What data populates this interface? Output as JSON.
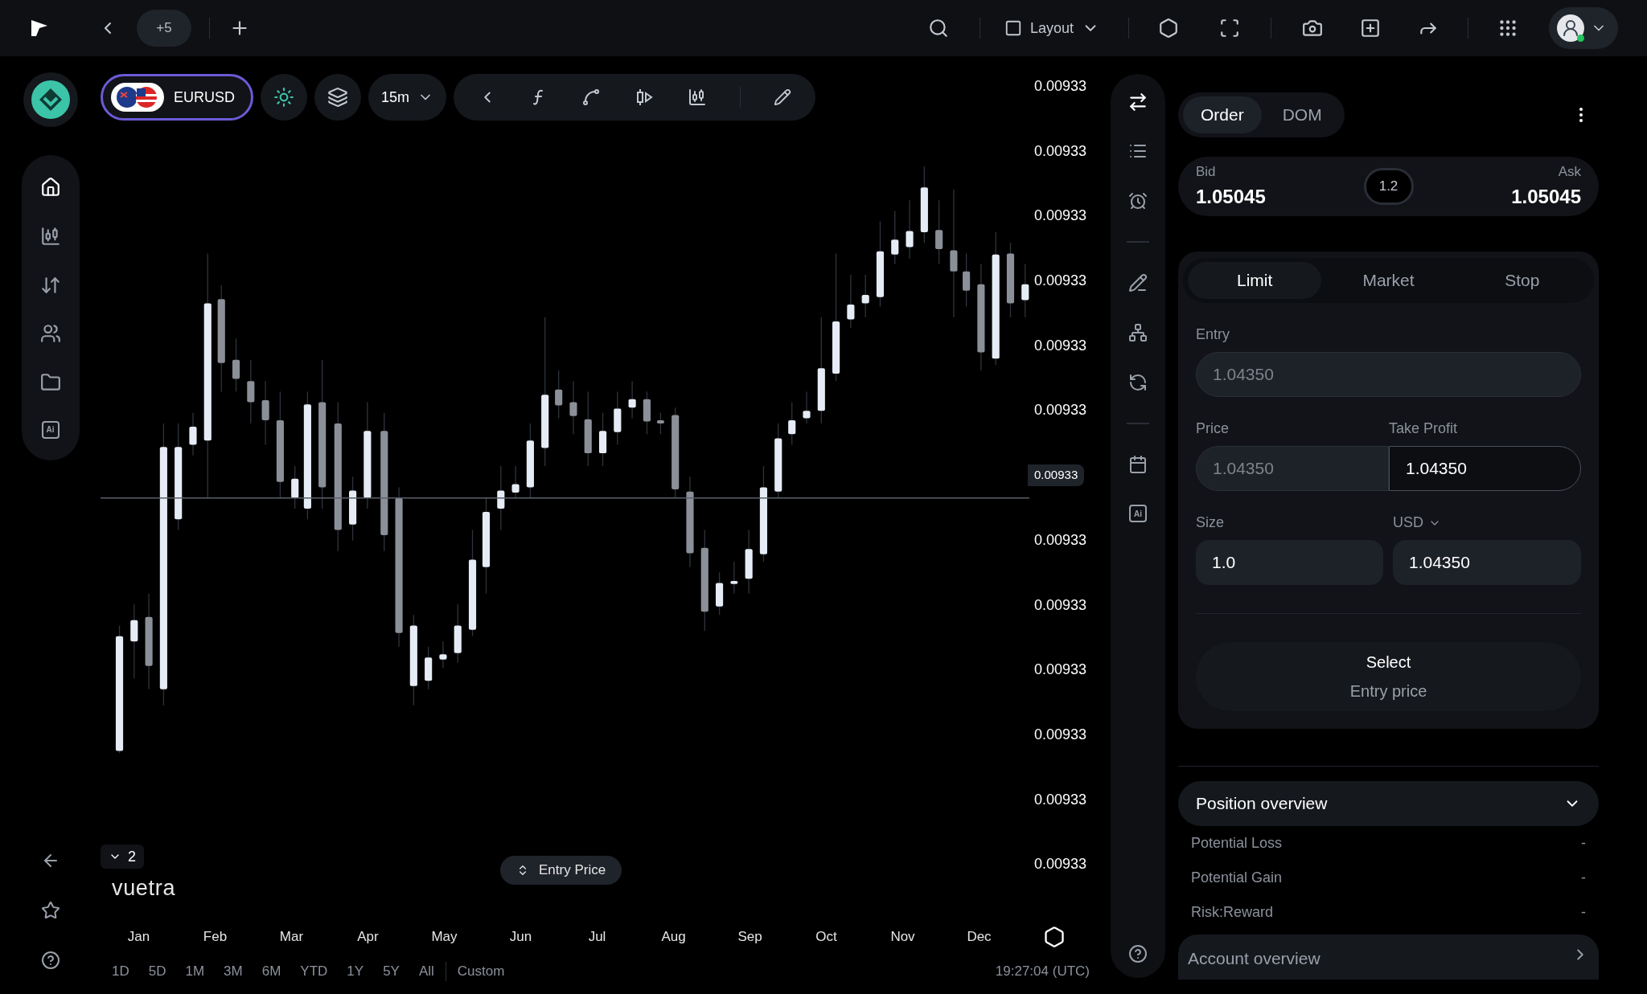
{
  "top_bar": {
    "tab_count": "+5",
    "layout_label": "Layout"
  },
  "sidebar": {
    "nav_items": [
      {
        "selected": true
      },
      {
        "selected": false
      },
      {
        "selected": false
      },
      {
        "selected": false
      },
      {
        "selected": false
      },
      {
        "selected": false
      }
    ],
    "ai_label": "Ai"
  },
  "toolbar": {
    "symbol": "EURUSD",
    "interval": "15m"
  },
  "chart": {
    "price_labels_upper": [
      "0.00933",
      "0.00933",
      "0.00933",
      "0.00933",
      "0.00933",
      "0.00933"
    ],
    "current_price": "0.00933",
    "price_labels_lower": [
      "0.00933",
      "0.00933",
      "0.00933",
      "0.00933",
      "0.00933",
      "0.00933"
    ],
    "series_count": "2",
    "brand": "vuetra",
    "entry_price_button": "Entry Price",
    "months": [
      "Jan",
      "Feb",
      "Mar",
      "Apr",
      "May",
      "Jun",
      "Jul",
      "Aug",
      "Sep",
      "Oct",
      "Nov",
      "Dec"
    ],
    "ranges": [
      "1D",
      "5D",
      "1M",
      "3M",
      "6M",
      "YTD",
      "1Y",
      "5Y",
      "All"
    ],
    "custom_range": "Custom",
    "time": "19:27:04 (UTC)"
  },
  "tool_column": {
    "ai_label": "Ai"
  },
  "order_panel": {
    "tabs": [
      {
        "label": "Order",
        "selected": true
      },
      {
        "label": "DOM",
        "selected": false
      }
    ],
    "bid_label": "Bid",
    "bid": "1.05045",
    "spread": "1.2",
    "ask_label": "Ask",
    "ask": "1.05045",
    "order_types": [
      {
        "label": "Limit",
        "selected": true
      },
      {
        "label": "Market",
        "selected": false
      },
      {
        "label": "Stop",
        "selected": false
      }
    ],
    "entry_label": "Entry",
    "entry_placeholder": "1.04350",
    "price_label": "Price",
    "price_placeholder": "1.04350",
    "take_profit_label": "Take Profit",
    "take_profit_value": "1.04350",
    "size_label": "Size",
    "currency": "USD",
    "size_value": "1.0",
    "amount_value": "1.04350",
    "select_button": {
      "title": "Select",
      "subtitle": "Entry price"
    },
    "position_overview": {
      "title": "Position overview",
      "expanded": true,
      "rows": [
        {
          "label": "Potential Loss",
          "value": "-"
        },
        {
          "label": "Potential Gain",
          "value": "-"
        },
        {
          "label": "Risk:Reward",
          "value": "-"
        }
      ]
    },
    "account_overview": {
      "title": "Account overview"
    }
  }
}
